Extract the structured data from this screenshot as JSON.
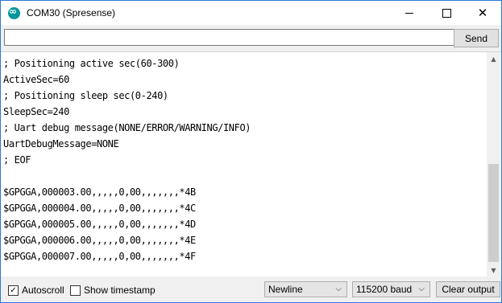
{
  "window": {
    "title": "COM30 (Spresense)",
    "app_icon": "arduino-icon"
  },
  "controls": {
    "minimize": "—",
    "maximize": "☐",
    "close": "✕"
  },
  "send": {
    "input_value": "",
    "button_label": "Send"
  },
  "output": {
    "lines": [
      "; Positioning active sec(60-300)",
      "ActiveSec=60",
      "; Positioning sleep sec(0-240)",
      "SleepSec=240",
      "; Uart debug message(NONE/ERROR/WARNING/INFO)",
      "UartDebugMessage=NONE",
      "; EOF",
      "",
      "$GPGGA,000003.00,,,,,0,00,,,,,,,*4B",
      "$GPGGA,000004.00,,,,,0,00,,,,,,,*4C",
      "$GPGGA,000005.00,,,,,0,00,,,,,,,*4D",
      "$GPGGA,000006.00,,,,,0,00,,,,,,,*4E",
      "$GPGGA,000007.00,,,,,0,00,,,,,,,*4F"
    ]
  },
  "footer": {
    "autoscroll": {
      "label": "Autoscroll",
      "checked": true,
      "mark": "✓"
    },
    "timestamp": {
      "label": "Show timestamp",
      "checked": false
    },
    "line_ending": "Newline",
    "baud_rate": "115200 baud",
    "clear_label": "Clear output"
  }
}
